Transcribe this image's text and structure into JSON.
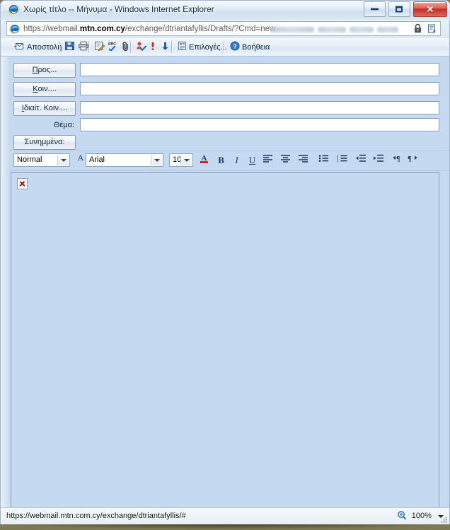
{
  "window": {
    "title": "Χωρίς τίτλο -- Μήνυμα - Windows Internet Explorer",
    "app_icon": "internet-explorer-icon",
    "controls": {
      "minimize": "minimize-icon",
      "maximize": "maximize-icon",
      "close": "✕"
    }
  },
  "address_bar": {
    "icon": "internet-explorer-icon",
    "url_prefix": "https://webmail.",
    "url_domain": "mtn.com.cy",
    "url_suffix": "/exchange/dtriantafyllis/Drafts/?Cmd=new",
    "full_url": "https://webmail.mtn.com.cy/exchange/dtriantafyllis/Drafts/?Cmd=new",
    "security_icon": "lock-icon",
    "compat_icon": "compatibility-view-icon"
  },
  "mail_toolbar": {
    "items": [
      {
        "name": "send",
        "label": "Αποστολή",
        "icon": "send-envelope-icon"
      },
      {
        "name": "save",
        "label": "",
        "icon": "save-disk-icon"
      },
      {
        "name": "print",
        "label": "",
        "icon": "printer-icon"
      },
      {
        "name": "signature",
        "label": "",
        "icon": "signature-icon"
      },
      {
        "name": "spelling",
        "label": "",
        "icon": "spell-check-abc-icon"
      },
      {
        "name": "attach",
        "label": "",
        "icon": "paperclip-icon"
      },
      {
        "name": "check-names",
        "label": "",
        "icon": "check-names-icon"
      },
      {
        "name": "high-importance",
        "label": "",
        "icon": "high-importance-icon"
      },
      {
        "name": "low-importance",
        "label": "",
        "icon": "low-importance-icon"
      },
      {
        "name": "options",
        "label": "Επιλογές...",
        "icon": "options-properties-icon"
      },
      {
        "name": "help",
        "label": "Βοήθεια",
        "icon": "help-circle-icon"
      }
    ]
  },
  "compose": {
    "rows": [
      {
        "name": "to",
        "label": "Προς...",
        "accel": "Π",
        "type": "button",
        "value": ""
      },
      {
        "name": "cc",
        "label": "Κοιν....",
        "accel": "Κ",
        "type": "button",
        "value": ""
      },
      {
        "name": "bcc",
        "label": "Ιδιαίτ. Κοιν....",
        "accel": "Ι",
        "type": "button",
        "value": ""
      },
      {
        "name": "subject",
        "label": "Θέμα:",
        "accel": "",
        "type": "label",
        "value": ""
      },
      {
        "name": "attachments",
        "label": "Συνημμένα:",
        "accel": "",
        "type": "button",
        "value": ""
      }
    ]
  },
  "format_toolbar": {
    "style_value": "Normal",
    "font_value": "Arial",
    "size_value": "10",
    "buttons": [
      {
        "name": "style-picker-icon",
        "glyph": "A"
      },
      {
        "name": "font-color-icon",
        "glyph": "A"
      },
      {
        "name": "bold-icon",
        "glyph": "B"
      },
      {
        "name": "italic-icon",
        "glyph": "I"
      },
      {
        "name": "underline-icon",
        "glyph": "U"
      },
      {
        "name": "align-left-icon",
        "glyph": ""
      },
      {
        "name": "align-center-icon",
        "glyph": ""
      },
      {
        "name": "align-right-icon",
        "glyph": ""
      },
      {
        "name": "bullet-list-icon",
        "glyph": ""
      },
      {
        "name": "numbered-list-icon",
        "glyph": ""
      },
      {
        "name": "decrease-indent-icon",
        "glyph": ""
      },
      {
        "name": "increase-indent-icon",
        "glyph": ""
      },
      {
        "name": "ltr-direction-icon",
        "glyph": ""
      },
      {
        "name": "rtl-direction-icon",
        "glyph": ""
      }
    ]
  },
  "message_body": {
    "content": "",
    "broken_image": "broken-image-icon"
  },
  "status_bar": {
    "url": "https://webmail.mtn.com.cy/exchange/dtriantafyllis/#",
    "zoom_icon": "zoom-magnifier-icon",
    "zoom_level": "100%"
  },
  "colors": {
    "compose_bg": "#c5daf1",
    "field_bg": "#ffffff",
    "toolbar_text": "#10243c",
    "close_button": "#c32f24",
    "broken_image_x": "#9c1111",
    "font_color_underline": "#e02020"
  }
}
